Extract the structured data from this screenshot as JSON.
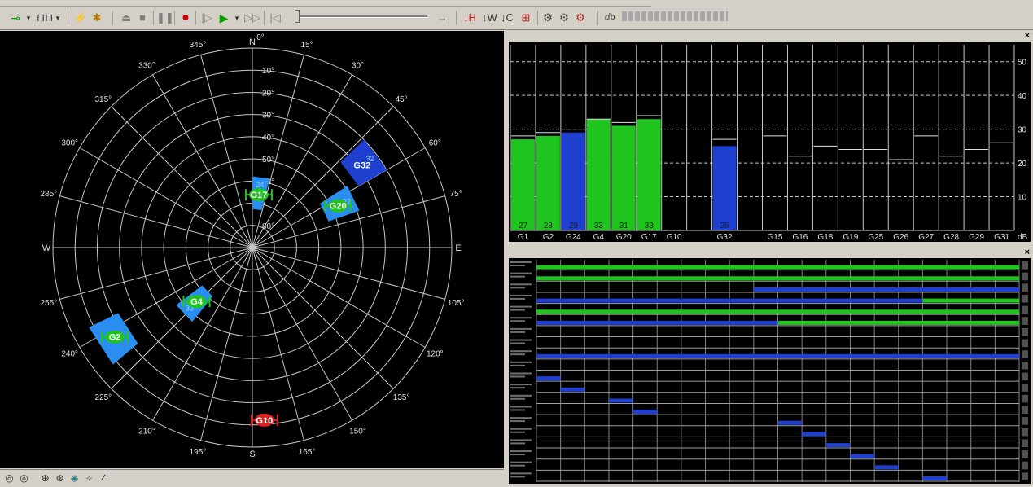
{
  "toolbar": {
    "icons": [
      "signal-icon",
      "waveform-icon",
      "wand-icon",
      "clear-icon",
      "eject-icon",
      "stop-icon",
      "pause-icon",
      "record-icon",
      "step-icon",
      "play-icon",
      "play-dropdown-icon",
      "fast-forward-icon",
      "rewind-start-icon",
      "playback-slider",
      "end-icon",
      "heading-icon",
      "width-icon",
      "time-icon",
      "plot-icon",
      "gear-icon",
      "gear-2-icon",
      "gear-3-icon",
      "status-icon"
    ]
  },
  "skyplot": {
    "cardinals": {
      "n": "N",
      "e": "E",
      "s": "S",
      "w": "W"
    },
    "azimuth_labels": [
      "0°",
      "15°",
      "30°",
      "45°",
      "60°",
      "75°",
      "105°",
      "120°",
      "135°",
      "150°",
      "165°",
      "195°",
      "210°",
      "225°",
      "240°",
      "255°",
      "285°",
      "300°",
      "315°",
      "330°",
      "345°"
    ],
    "elevation_labels": [
      "10°",
      "20°",
      "30°",
      "40°",
      "50°",
      "60°",
      "80°"
    ],
    "satellites": [
      {
        "id": "G32",
        "az": 53,
        "el": 28,
        "color": "#1e3fd0",
        "snr": "32",
        "used": true
      },
      {
        "id": "G17",
        "az": 7,
        "el": 66,
        "color": "#1fc41f",
        "snr": "24",
        "used": true
      },
      {
        "id": "G20",
        "az": 64,
        "el": 47,
        "color": "#1fc41f",
        "snr": "32",
        "used": true
      },
      {
        "id": "G4",
        "az": 226,
        "el": 55,
        "color": "#1fc41f",
        "snr": "33",
        "used": true
      },
      {
        "id": "G2",
        "az": 237,
        "el": 16,
        "color": "#1fc41f",
        "snr": "",
        "used": true
      },
      {
        "id": "G10",
        "az": 176,
        "el": 12,
        "color": "#e02020",
        "snr": "",
        "used": false
      }
    ]
  },
  "snr_chart": {
    "unit": "dB",
    "yticks": [
      "50",
      "40",
      "30",
      "20",
      "10"
    ],
    "bars": [
      {
        "id": "G1",
        "value": 27,
        "line": 28,
        "color": "#1fc41f",
        "label": "27"
      },
      {
        "id": "G2",
        "value": 28,
        "line": 29,
        "color": "#1fc41f",
        "label": "28"
      },
      {
        "id": "G24",
        "value": 29,
        "line": 30,
        "color": "#1e3fd0",
        "label": "29"
      },
      {
        "id": "G4",
        "value": 33,
        "line": 33,
        "color": "#1fc41f",
        "label": "33"
      },
      {
        "id": "G20",
        "value": 31,
        "line": 32,
        "color": "#1fc41f",
        "label": "31"
      },
      {
        "id": "G17",
        "value": 33,
        "line": 34,
        "color": "#1fc41f",
        "label": "33"
      },
      {
        "id": "G10",
        "value": 0,
        "line": 0,
        "color": "#000000",
        "label": ""
      },
      {
        "id": "",
        "value": 0,
        "line": 0,
        "color": "#000000",
        "label": ""
      },
      {
        "id": "G32",
        "value": 25,
        "line": 27,
        "color": "#1e3fd0",
        "label": "25"
      },
      {
        "id": "",
        "value": 0,
        "line": 0,
        "color": "#000000",
        "label": ""
      },
      {
        "id": "G15",
        "value": 0,
        "line": 28,
        "color": "#000000",
        "label": ""
      },
      {
        "id": "G16",
        "value": 0,
        "line": 22,
        "color": "#000000",
        "label": ""
      },
      {
        "id": "G18",
        "value": 0,
        "line": 25,
        "color": "#000000",
        "label": ""
      },
      {
        "id": "G19",
        "value": 0,
        "line": 24,
        "color": "#000000",
        "label": ""
      },
      {
        "id": "G25",
        "value": 0,
        "line": 24,
        "color": "#000000",
        "label": ""
      },
      {
        "id": "G26",
        "value": 0,
        "line": 21,
        "color": "#000000",
        "label": ""
      },
      {
        "id": "G27",
        "value": 0,
        "line": 28,
        "color": "#000000",
        "label": ""
      },
      {
        "id": "G28",
        "value": 0,
        "line": 22,
        "color": "#000000",
        "label": ""
      },
      {
        "id": "G29",
        "value": 0,
        "line": 24,
        "color": "#000000",
        "label": ""
      },
      {
        "id": "G31",
        "value": 0,
        "line": 26,
        "color": "#000000",
        "label": ""
      }
    ]
  },
  "tracking": {
    "rows": [
      {
        "segs": [
          [
            0,
            1,
            "#1fc41f"
          ]
        ]
      },
      {
        "segs": [
          [
            0,
            1,
            "#1fc41f"
          ]
        ]
      },
      {
        "segs": [
          [
            0.45,
            1,
            "#1e3fd0"
          ]
        ]
      },
      {
        "segs": [
          [
            0,
            0.8,
            "#1e3fd0"
          ],
          [
            0.8,
            1,
            "#1fc41f"
          ]
        ]
      },
      {
        "segs": [
          [
            0,
            1,
            "#1fc41f"
          ]
        ]
      },
      {
        "segs": [
          [
            0,
            0.5,
            "#1e3fd0"
          ],
          [
            0.5,
            1,
            "#1fc41f"
          ]
        ]
      },
      {
        "segs": []
      },
      {
        "segs": []
      },
      {
        "segs": [
          [
            0,
            1,
            "#1e3fd0"
          ]
        ]
      },
      {
        "segs": []
      },
      {
        "segs": [
          [
            0,
            0.05,
            "#1e3fd0"
          ]
        ]
      },
      {
        "segs": [
          [
            0.05,
            0.1,
            "#1e3fd0"
          ]
        ]
      },
      {
        "segs": [
          [
            0.15,
            0.2,
            "#1e3fd0"
          ]
        ]
      },
      {
        "segs": [
          [
            0.2,
            0.25,
            "#1e3fd0"
          ]
        ]
      },
      {
        "segs": [
          [
            0.5,
            0.55,
            "#1e3fd0"
          ]
        ]
      },
      {
        "segs": [
          [
            0.55,
            0.6,
            "#1e3fd0"
          ]
        ]
      },
      {
        "segs": [
          [
            0.6,
            0.65,
            "#1e3fd0"
          ]
        ]
      },
      {
        "segs": [
          [
            0.65,
            0.7,
            "#1e3fd0"
          ]
        ]
      },
      {
        "segs": [
          [
            0.7,
            0.75,
            "#1e3fd0"
          ]
        ]
      },
      {
        "segs": [
          [
            0.8,
            0.85,
            "#1e3fd0"
          ]
        ]
      }
    ]
  }
}
